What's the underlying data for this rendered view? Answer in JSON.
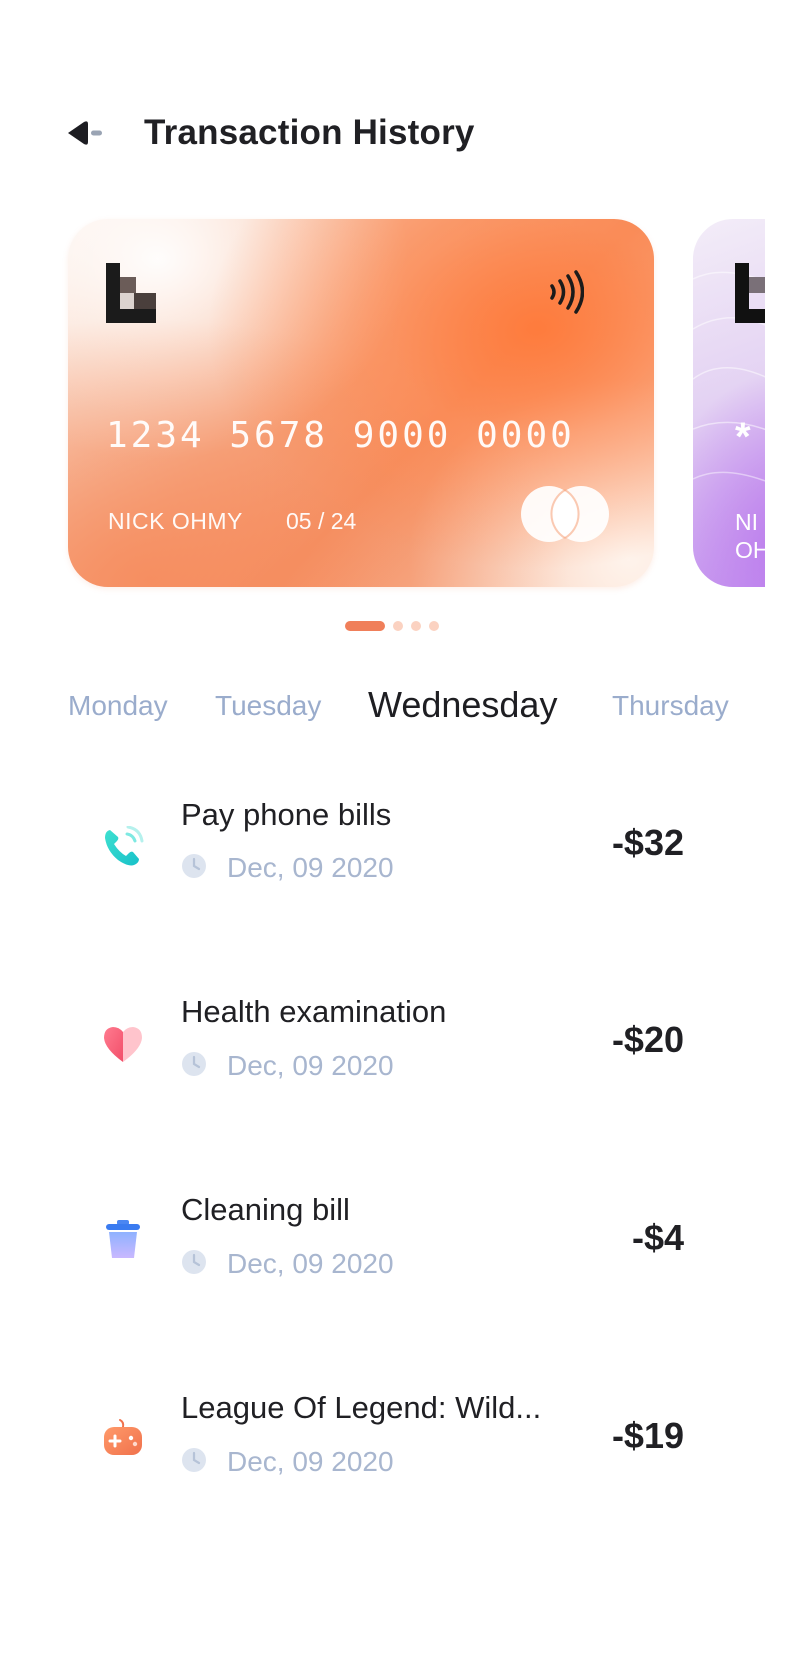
{
  "header": {
    "title": "Transaction History",
    "back_icon": "back-arrow-icon"
  },
  "cards": [
    {
      "number": "1234  5678  9000  0000",
      "holder": "NICK OHMY",
      "expiry": "05 / 24",
      "theme_color": "#f48b5a",
      "icons": [
        "bank-logo-icon",
        "contactless-icon",
        "card-brand-icon"
      ]
    },
    {
      "number_masked": "*",
      "holder_lines": [
        "NI",
        "OH"
      ],
      "theme_color": "#c79af0"
    }
  ],
  "pager": {
    "count": 4,
    "active_index": 0,
    "active_color": "#f07f5a",
    "inactive_color": "#fbd2c1"
  },
  "days": {
    "items": [
      "Monday",
      "Tuesday",
      "Wednesday",
      "Thursday"
    ],
    "selected": "Wednesday"
  },
  "transactions": [
    {
      "title": "Pay phone bills",
      "date": "Dec, 09 2020",
      "amount": "-$32",
      "icon": "phone-icon"
    },
    {
      "title": "Health examination",
      "date": "Dec, 09 2020",
      "amount": "-$20",
      "icon": "heart-icon"
    },
    {
      "title": "Cleaning bill",
      "date": "Dec, 09 2020",
      "amount": "-$4",
      "icon": "trash-bin-icon"
    },
    {
      "title": "League Of Legend: Wild...",
      "date": "Dec, 09 2020",
      "amount": "-$19",
      "icon": "gamepad-icon"
    }
  ],
  "colors": {
    "accent": "#f07f5a",
    "muted_text": "#a8b6cf",
    "tab_inactive": "#9aaccc",
    "text": "#202024"
  }
}
